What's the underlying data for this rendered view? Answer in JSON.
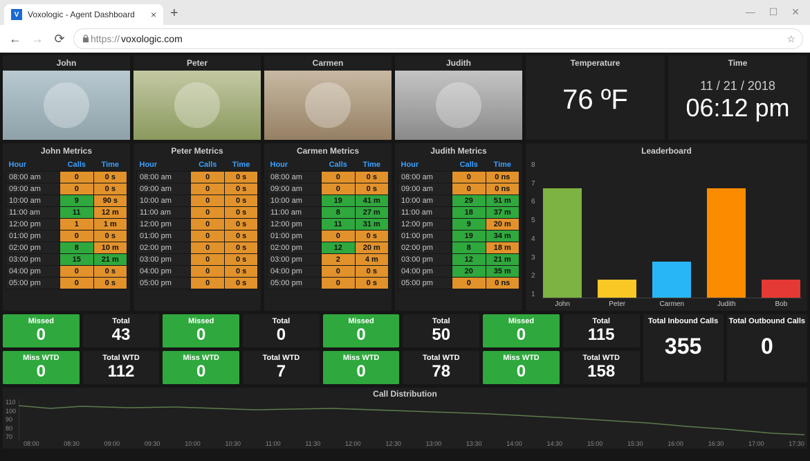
{
  "browser": {
    "tab_title": "Voxologic - Agent Dashboard",
    "url_proto": "https://",
    "url_rest": "voxologic.com",
    "favicon_letter": "V"
  },
  "agents": [
    {
      "name": "John",
      "photo_class": "ph-john"
    },
    {
      "name": "Peter",
      "photo_class": "ph-peter"
    },
    {
      "name": "Carmen",
      "photo_class": "ph-carmen"
    },
    {
      "name": "Judith",
      "photo_class": "ph-judith"
    }
  ],
  "temperature": {
    "label": "Temperature",
    "value": "76 ºF"
  },
  "clock": {
    "label": "Time",
    "date": "11 / 21 / 2018",
    "time": "06:12 pm"
  },
  "metrics_columns": [
    "Hour",
    "Calls",
    "Time"
  ],
  "metrics": {
    "John": {
      "title": "John Metrics",
      "rows": [
        {
          "h": "08:00 am",
          "c": "0",
          "cc": "c-orange",
          "t": "0 s",
          "tc": "c-orange"
        },
        {
          "h": "09:00 am",
          "c": "0",
          "cc": "c-orange",
          "t": "0 s",
          "tc": "c-orange"
        },
        {
          "h": "10:00 am",
          "c": "9",
          "cc": "c-green",
          "t": "90 s",
          "tc": "c-orange"
        },
        {
          "h": "11:00 am",
          "c": "11",
          "cc": "c-green",
          "t": "12 m",
          "tc": "c-orange"
        },
        {
          "h": "12:00 pm",
          "c": "1",
          "cc": "c-orange",
          "t": "1 m",
          "tc": "c-orange"
        },
        {
          "h": "01:00 pm",
          "c": "0",
          "cc": "c-orange",
          "t": "0 s",
          "tc": "c-orange"
        },
        {
          "h": "02:00 pm",
          "c": "8",
          "cc": "c-green",
          "t": "10 m",
          "tc": "c-orange"
        },
        {
          "h": "03:00 pm",
          "c": "15",
          "cc": "c-green",
          "t": "21 m",
          "tc": "c-green"
        },
        {
          "h": "04:00 pm",
          "c": "0",
          "cc": "c-orange",
          "t": "0 s",
          "tc": "c-orange"
        },
        {
          "h": "05:00 pm",
          "c": "0",
          "cc": "c-orange",
          "t": "0 s",
          "tc": "c-orange"
        }
      ]
    },
    "Peter": {
      "title": "Peter Metrics",
      "rows": [
        {
          "h": "08:00 am",
          "c": "0",
          "cc": "c-orange",
          "t": "0 s",
          "tc": "c-orange"
        },
        {
          "h": "09:00 am",
          "c": "0",
          "cc": "c-orange",
          "t": "0 s",
          "tc": "c-orange"
        },
        {
          "h": "10:00 am",
          "c": "0",
          "cc": "c-orange",
          "t": "0 s",
          "tc": "c-orange"
        },
        {
          "h": "11:00 am",
          "c": "0",
          "cc": "c-orange",
          "t": "0 s",
          "tc": "c-orange"
        },
        {
          "h": "12:00 pm",
          "c": "0",
          "cc": "c-orange",
          "t": "0 s",
          "tc": "c-orange"
        },
        {
          "h": "01:00 pm",
          "c": "0",
          "cc": "c-orange",
          "t": "0 s",
          "tc": "c-orange"
        },
        {
          "h": "02:00 pm",
          "c": "0",
          "cc": "c-orange",
          "t": "0 s",
          "tc": "c-orange"
        },
        {
          "h": "03:00 pm",
          "c": "0",
          "cc": "c-orange",
          "t": "0 s",
          "tc": "c-orange"
        },
        {
          "h": "04:00 pm",
          "c": "0",
          "cc": "c-orange",
          "t": "0 s",
          "tc": "c-orange"
        },
        {
          "h": "05:00 pm",
          "c": "0",
          "cc": "c-orange",
          "t": "0 s",
          "tc": "c-orange"
        }
      ]
    },
    "Carmen": {
      "title": "Carmen Metrics",
      "rows": [
        {
          "h": "08:00 am",
          "c": "0",
          "cc": "c-orange",
          "t": "0 s",
          "tc": "c-orange"
        },
        {
          "h": "09:00 am",
          "c": "0",
          "cc": "c-orange",
          "t": "0 s",
          "tc": "c-orange"
        },
        {
          "h": "10:00 am",
          "c": "19",
          "cc": "c-green",
          "t": "41 m",
          "tc": "c-green"
        },
        {
          "h": "11:00 am",
          "c": "8",
          "cc": "c-green",
          "t": "27 m",
          "tc": "c-green"
        },
        {
          "h": "12:00 pm",
          "c": "11",
          "cc": "c-green",
          "t": "31 m",
          "tc": "c-green"
        },
        {
          "h": "01:00 pm",
          "c": "0",
          "cc": "c-orange",
          "t": "0 s",
          "tc": "c-orange"
        },
        {
          "h": "02:00 pm",
          "c": "12",
          "cc": "c-green",
          "t": "20 m",
          "tc": "c-orange"
        },
        {
          "h": "03:00 pm",
          "c": "2",
          "cc": "c-orange",
          "t": "4 m",
          "tc": "c-orange"
        },
        {
          "h": "04:00 pm",
          "c": "0",
          "cc": "c-orange",
          "t": "0 s",
          "tc": "c-orange"
        },
        {
          "h": "05:00 pm",
          "c": "0",
          "cc": "c-orange",
          "t": "0 s",
          "tc": "c-orange"
        }
      ]
    },
    "Judith": {
      "title": "Judith Metrics",
      "rows": [
        {
          "h": "08:00 am",
          "c": "0",
          "cc": "c-orange",
          "t": "0 ns",
          "tc": "c-orange"
        },
        {
          "h": "09:00 am",
          "c": "0",
          "cc": "c-orange",
          "t": "0 ns",
          "tc": "c-orange"
        },
        {
          "h": "10:00 am",
          "c": "29",
          "cc": "c-green",
          "t": "51 m",
          "tc": "c-green"
        },
        {
          "h": "11:00 am",
          "c": "18",
          "cc": "c-green",
          "t": "37 m",
          "tc": "c-green"
        },
        {
          "h": "12:00 pm",
          "c": "9",
          "cc": "c-green",
          "t": "20 m",
          "tc": "c-orange"
        },
        {
          "h": "01:00 pm",
          "c": "19",
          "cc": "c-green",
          "t": "34 m",
          "tc": "c-green"
        },
        {
          "h": "02:00 pm",
          "c": "8",
          "cc": "c-green",
          "t": "18 m",
          "tc": "c-orange"
        },
        {
          "h": "03:00 pm",
          "c": "12",
          "cc": "c-green",
          "t": "21 m",
          "tc": "c-green"
        },
        {
          "h": "04:00 pm",
          "c": "20",
          "cc": "c-green",
          "t": "35 m",
          "tc": "c-green"
        },
        {
          "h": "05:00 pm",
          "c": "0",
          "cc": "c-orange",
          "t": "0 ns",
          "tc": "c-orange"
        }
      ]
    }
  },
  "stats": {
    "missed_label": "Missed",
    "total_label": "Total",
    "misswtd_label": "Miss WTD",
    "totalwtd_label": "Total WTD",
    "John": {
      "missed": "0",
      "total": "43",
      "misswtd": "0",
      "totalwtd": "112"
    },
    "Peter": {
      "missed": "0",
      "total": "0",
      "misswtd": "0",
      "totalwtd": "7"
    },
    "Carmen": {
      "missed": "0",
      "total": "50",
      "misswtd": "0",
      "totalwtd": "78"
    },
    "Judith": {
      "missed": "0",
      "total": "115",
      "misswtd": "0",
      "totalwtd": "158"
    }
  },
  "totals": {
    "inbound_label": "Total Inbound Calls",
    "inbound": "355",
    "outbound_label": "Total Outbound Calls",
    "outbound": "0"
  },
  "leaderboard": {
    "title": "Leaderboard",
    "ylim": [
      1,
      8
    ]
  },
  "calldist": {
    "title": "Call Distribution",
    "yticks": [
      "110",
      "100",
      "90",
      "80",
      "70"
    ],
    "xticks": [
      "08:00",
      "08:30",
      "09:00",
      "09:30",
      "10:00",
      "10:30",
      "11:00",
      "11:30",
      "12:00",
      "12:30",
      "13:00",
      "13:30",
      "14:00",
      "14:30",
      "15:00",
      "15:30",
      "16:00",
      "16:30",
      "17:00",
      "17:30"
    ]
  },
  "chart_data": {
    "type": "bar",
    "title": "Leaderboard",
    "categories": [
      "John",
      "Peter",
      "Carmen",
      "Judith",
      "Bob"
    ],
    "values": [
      7,
      2,
      3,
      7,
      2
    ],
    "colors": [
      "#7cb342",
      "#f9c825",
      "#29b6f6",
      "#fb8c00",
      "#e53935"
    ],
    "ylim": [
      1,
      8
    ]
  }
}
